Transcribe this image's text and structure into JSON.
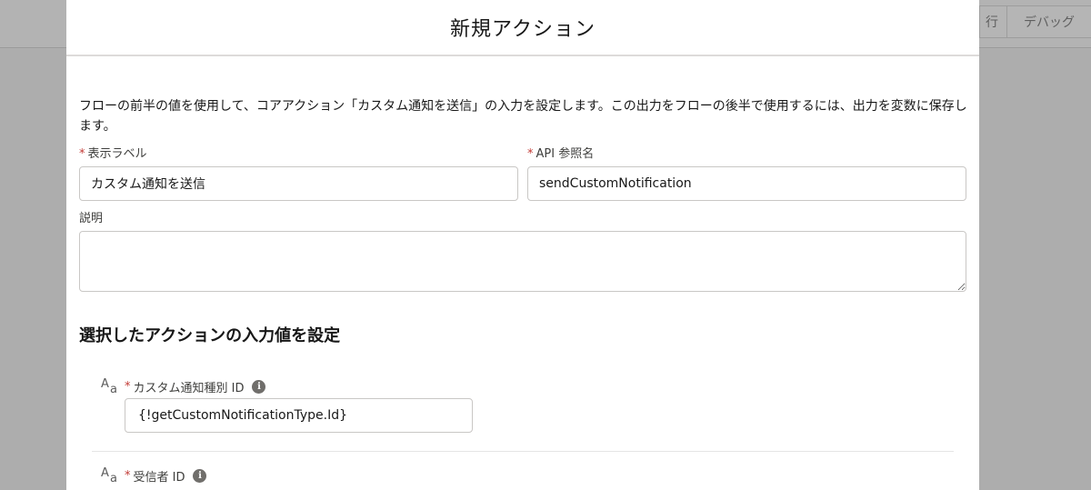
{
  "background": {
    "tabs": [
      {
        "label": "行"
      },
      {
        "label": "デバッグ"
      }
    ]
  },
  "modal": {
    "title": "新規アクション",
    "description": "フローの前半の値を使用して、コアアクション「カスタム通知を送信」の入力を設定します。この出力をフローの後半で使用するには、出力を変数に保存します。",
    "required_marker": "*",
    "label_field": {
      "label": "表示ラベル",
      "value": "カスタム通知を送信"
    },
    "api_field": {
      "label": "API 参照名",
      "value": "sendCustomNotification"
    },
    "description_field": {
      "label": "説明",
      "value": ""
    },
    "inputs_section": {
      "heading": "選択したアクションの入力値を設定",
      "type_icon_big": "A",
      "type_icon_small": "a",
      "info_glyph": "i",
      "inputs": [
        {
          "label": "カスタム通知種別 ID",
          "value": "{!getCustomNotificationType.Id}"
        },
        {
          "label": "受信者 ID",
          "value": ""
        }
      ]
    }
  },
  "colors": {
    "required": "#c23934",
    "overlay": "#b0b0b0"
  }
}
